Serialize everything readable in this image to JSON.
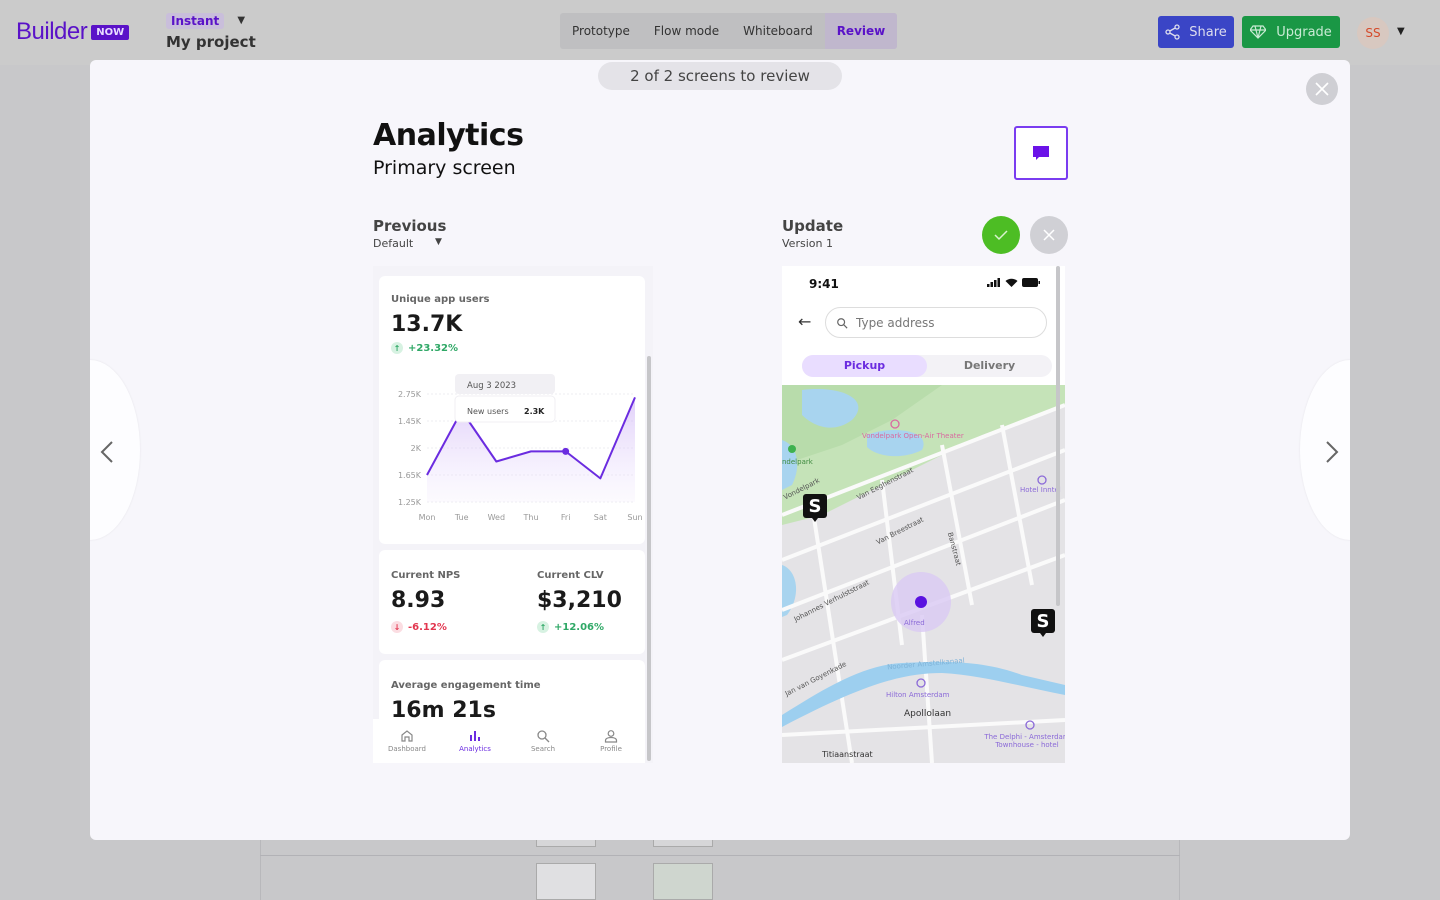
{
  "topbar": {
    "logo_text": "Builder",
    "logo_badge": "NOW",
    "plan_badge": "Instant",
    "project_name": "My project",
    "modes": [
      {
        "label": "Prototype",
        "active": false
      },
      {
        "label": "Flow mode",
        "active": false
      },
      {
        "label": "Whiteboard",
        "active": false
      },
      {
        "label": "Review",
        "active": true
      }
    ],
    "share_label": "Share",
    "upgrade_label": "Upgrade",
    "avatar_initials": "SS"
  },
  "modal": {
    "review_count": "2 of 2 screens to review",
    "screen_title": "Analytics",
    "screen_subtitle": "Primary screen",
    "previous": {
      "label": "Previous",
      "variant": "Default"
    },
    "update": {
      "label": "Update",
      "version": "Version 1"
    }
  },
  "analytics_screen": {
    "unique_users": {
      "label": "Unique app users",
      "value": "13.7K",
      "delta": "+23.32%"
    },
    "chart": {
      "tooltip_date": "Aug 3 2023",
      "tooltip_label": "New users",
      "tooltip_value": "2.3K"
    },
    "nps": {
      "label": "Current NPS",
      "value": "8.93",
      "delta": "-6.12%"
    },
    "clv": {
      "label": "Current CLV",
      "value": "$3,210",
      "delta": "+12.06%"
    },
    "engagement": {
      "label": "Average engagement time",
      "value": "16m 21s"
    },
    "tabs": [
      {
        "label": "Dashboard",
        "icon": "home-icon",
        "active": false
      },
      {
        "label": "Analytics",
        "icon": "bar-chart-icon",
        "active": true
      },
      {
        "label": "Search",
        "icon": "search-icon",
        "active": false
      },
      {
        "label": "Profile",
        "icon": "user-icon",
        "active": false
      }
    ]
  },
  "chart_data": {
    "type": "line",
    "title": "Unique app users",
    "categories": [
      "Mon",
      "Tue",
      "Wed",
      "Thu",
      "Fri",
      "Sat",
      "Sun"
    ],
    "y_tick_labels": [
      "2.75K",
      "1.45K",
      "2K",
      "1.65K",
      "1.25K"
    ],
    "values": [
      1.65,
      2.6,
      1.85,
      2.0,
      2.0,
      1.6,
      2.8
    ],
    "highlight_index": 4,
    "ylim": [
      1.25,
      2.85
    ],
    "grid": true,
    "legend": "none",
    "color": "#6b2ce0"
  },
  "map_screen": {
    "time": "9:41",
    "address_placeholder": "Type address",
    "segments": [
      {
        "label": "Pickup",
        "active": true
      },
      {
        "label": "Delivery",
        "active": false
      }
    ],
    "map_labels": {
      "streets": [
        "Van Eeghenstraat",
        "Van Breestraat",
        "Banstraat",
        "Johannes Verhulststraat",
        "Jan van Goyenkade",
        "Apollolaan",
        "Titiaanstraat",
        "Vondelpark",
        "Noorder Amstelkanaal"
      ],
      "pois": [
        "Vondelpark Open-Air Theater",
        "Hotel Inntel",
        "Alfred",
        "Hilton Amsterdam",
        "The Delphi - Amsterdam Townhouse - hotel",
        "ndelpark"
      ]
    }
  }
}
